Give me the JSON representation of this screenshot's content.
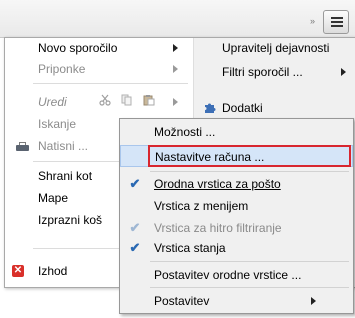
{
  "toolbar": {
    "overflow_icon": "chevron-right-double-icon",
    "menu_button_icon": "hamburger-menu-icon"
  },
  "app_menu": {
    "left": [
      {
        "label": "Novo sporočilo",
        "enabled": true,
        "submenu": true
      },
      {
        "label": "Priponke",
        "enabled": false,
        "submenu": true
      },
      {
        "label": "Uredi",
        "enabled": false,
        "submenu": true
      },
      {
        "label": "Iskanje",
        "enabled": false,
        "submenu": false
      },
      {
        "label": "Natisni ...",
        "enabled": false,
        "submenu": false
      },
      {
        "label": "Shrani kot",
        "enabled": true,
        "submenu": true
      },
      {
        "label": "Mape",
        "enabled": true,
        "submenu": false
      },
      {
        "label": "Izprazni koš",
        "enabled": true,
        "submenu": false
      },
      {
        "label": "Izhod",
        "enabled": true,
        "submenu": false
      }
    ],
    "right": [
      {
        "label": "Upravitelj dejavnosti",
        "submenu": false
      },
      {
        "label": "Filtri sporočil ...",
        "submenu": true
      },
      {
        "label": "Dodatki",
        "submenu": false
      }
    ]
  },
  "options_submenu": {
    "items": [
      {
        "label": "Možnosti ...",
        "checked": false,
        "enabled": true,
        "submenu": false,
        "highlighted": false
      },
      {
        "label": "Nastavitve računa ...",
        "checked": false,
        "enabled": true,
        "submenu": false,
        "highlighted": true
      },
      {
        "label": "Orodna vrstica za pošto",
        "checked": true,
        "enabled": true,
        "submenu": false,
        "highlighted": false
      },
      {
        "label": "Vrstica z menijem",
        "checked": false,
        "enabled": true,
        "submenu": false,
        "highlighted": false
      },
      {
        "label": "Vrstica za hitro filtriranje",
        "checked": true,
        "enabled": false,
        "submenu": false,
        "highlighted": false
      },
      {
        "label": "Vrstica stanja",
        "checked": true,
        "enabled": true,
        "submenu": false,
        "highlighted": false
      },
      {
        "label": "Postavitev orodne vrstice ...",
        "checked": false,
        "enabled": true,
        "submenu": false,
        "highlighted": false
      },
      {
        "label": "Postavitev",
        "checked": false,
        "enabled": true,
        "submenu": true,
        "highlighted": false
      }
    ]
  },
  "colors": {
    "highlight_bg": "#d5e5f8",
    "highlight_border": "#a9c6ec",
    "annotation_red": "#d8262f",
    "check_blue": "#2a69b3"
  }
}
